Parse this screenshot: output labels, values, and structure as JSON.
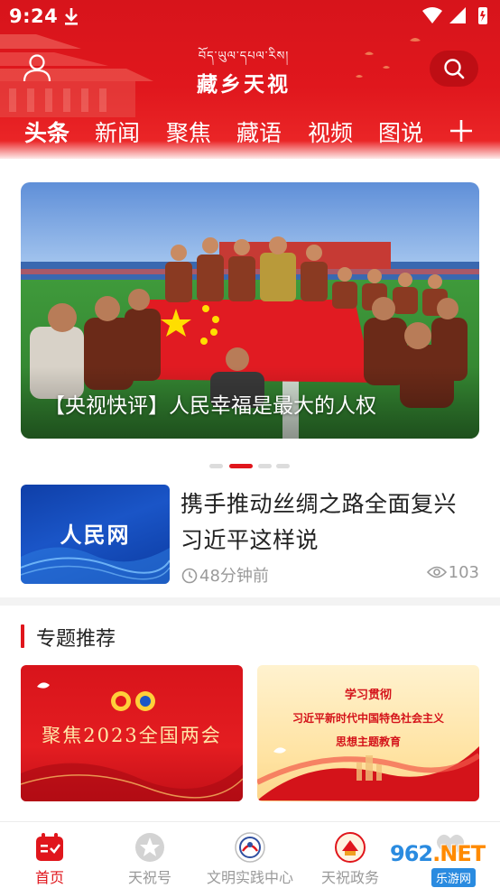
{
  "status_bar": {
    "time": "9:24"
  },
  "header": {
    "logo_tibetan": "བོད་ཡུལ་དཔལ་རིས།",
    "logo_chinese": "藏乡天视",
    "tabs": [
      {
        "label": "头条",
        "active": true
      },
      {
        "label": "新闻",
        "active": false
      },
      {
        "label": "聚焦",
        "active": false
      },
      {
        "label": "藏语",
        "active": false
      },
      {
        "label": "视频",
        "active": false
      },
      {
        "label": "图说",
        "active": false
      }
    ],
    "colors": {
      "brand_red": "#e0161c"
    }
  },
  "banner": {
    "title": "【央视快评】人民幸福是最大的人权",
    "slide_count": 4,
    "active_slide": 2
  },
  "news": [
    {
      "thumbnail_label": "人民网",
      "title": "携手推动丝绸之路全面复兴 习近平这样说",
      "time": "48分钟前",
      "views": "103"
    }
  ],
  "topics": {
    "heading": "专题推荐",
    "cards": [
      {
        "title": "聚焦2023全国两会"
      },
      {
        "line1": "学习贯彻",
        "line2": "习近平新时代中国特色社会主义",
        "line3": "思想主题教育"
      }
    ]
  },
  "bottom_nav": [
    {
      "label": "首页",
      "icon": "calendar-icon",
      "active": true
    },
    {
      "label": "天祝号",
      "icon": "star-badge-icon",
      "active": false
    },
    {
      "label": "文明实践中心",
      "icon": "civilization-emblem-icon",
      "active": false
    },
    {
      "label": "天祝政务",
      "icon": "government-emblem-icon",
      "active": false
    },
    {
      "label": "",
      "icon": "heart-icon",
      "active": false
    }
  ],
  "watermark": {
    "brand": "962",
    "domain": ".NET",
    "sub": "乐游网"
  }
}
